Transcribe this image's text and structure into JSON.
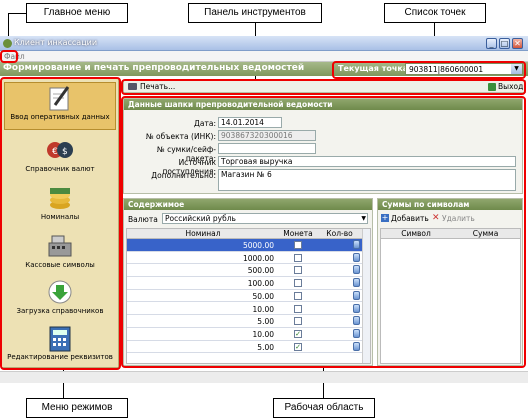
{
  "callouts": {
    "main_menu": "Главное меню",
    "toolbar": "Панель инструментов",
    "points_list": "Список точек",
    "modes_menu": "Меню режимов",
    "work_area": "Рабочая область"
  },
  "window": {
    "title": "Клиент инкассации",
    "menu_file": "Файл"
  },
  "header": {
    "title": "Формирование и печать препроводительных ведомостей",
    "current_point_label": "Текущая точка",
    "current_point_value": "903811|860600001"
  },
  "toolbar": {
    "print": "Печать...",
    "exit": "Выход"
  },
  "sidebar": {
    "items": [
      {
        "label": "Ввод оперативных данных",
        "icon": "pen-paper-icon"
      },
      {
        "label": "Справочник валют",
        "icon": "currency-icon"
      },
      {
        "label": "Номиналы",
        "icon": "coins-icon"
      },
      {
        "label": "Кассовые символы",
        "icon": "cash-register-icon"
      },
      {
        "label": "Загрузка справочников",
        "icon": "download-icon"
      },
      {
        "label": "Редактирование реквизитов",
        "icon": "calculator-icon"
      }
    ]
  },
  "header_panel": {
    "title": "Данные шапки препроводительной ведомости",
    "date_label": "Дата:",
    "date_value": "14.01.2014",
    "object_label": "№ объекта (ИНК):",
    "object_value": "903867320300016",
    "bag_label": "№ сумки/сейф-пакета:",
    "bag_value": "",
    "source_label": "Источник поступления:",
    "source_value": "Торговая выручка",
    "extra_label": "Дополнительно:",
    "extra_value": "Магазин № 6"
  },
  "content_panel": {
    "title": "Содержимое",
    "currency_label": "Валюта",
    "currency_value": "Российский рубль",
    "columns": [
      "Номинал",
      "Монета",
      "Кол-во"
    ],
    "rows": [
      {
        "nominal": "5000.00",
        "coin": false
      },
      {
        "nominal": "1000.00",
        "coin": false
      },
      {
        "nominal": "500.00",
        "coin": false
      },
      {
        "nominal": "100.00",
        "coin": false
      },
      {
        "nominal": "50.00",
        "coin": false
      },
      {
        "nominal": "10.00",
        "coin": false
      },
      {
        "nominal": "5.00",
        "coin": false
      },
      {
        "nominal": "10.00",
        "coin": true
      },
      {
        "nominal": "5.00",
        "coin": true
      }
    ]
  },
  "sums_panel": {
    "title": "Суммы по символам",
    "add": "Добавить",
    "delete": "Удалить",
    "columns": [
      "Символ",
      "Сумма"
    ]
  }
}
